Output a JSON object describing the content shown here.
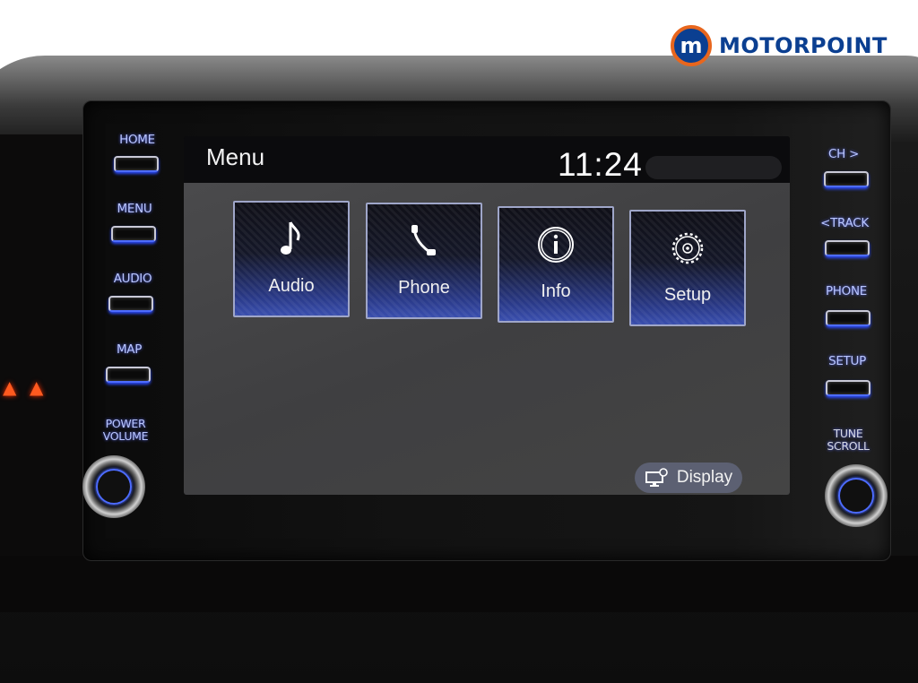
{
  "brand": {
    "logo_letter": "m",
    "name": "MOTORPOINT",
    "colors": {
      "blue": "#0b3f91",
      "orange": "#e8661d"
    }
  },
  "hardware_left": [
    {
      "label": "HOME"
    },
    {
      "label": "MENU"
    },
    {
      "label": "AUDIO"
    },
    {
      "label": "MAP"
    }
  ],
  "hardware_right": [
    {
      "label": "CH >"
    },
    {
      "label": "<TRACK"
    },
    {
      "label": "PHONE"
    },
    {
      "label": "SETUP"
    }
  ],
  "knobs": {
    "left": {
      "line1": "POWER",
      "line2": "VOLUME"
    },
    "right": {
      "line1": "TUNE",
      "line2": "SCROLL"
    }
  },
  "warning_lights": [
    "seatbelt-icon",
    "seatbelt-icon"
  ],
  "screen": {
    "title": "Menu",
    "clock": "11:24",
    "tiles": [
      {
        "label": "Audio",
        "icon": "music-note-icon"
      },
      {
        "label": "Phone",
        "icon": "phone-icon"
      },
      {
        "label": "Info",
        "icon": "info-icon"
      },
      {
        "label": "Setup",
        "icon": "gear-icon"
      }
    ],
    "display_button": {
      "label": "Display",
      "icon": "display-settings-icon"
    }
  }
}
